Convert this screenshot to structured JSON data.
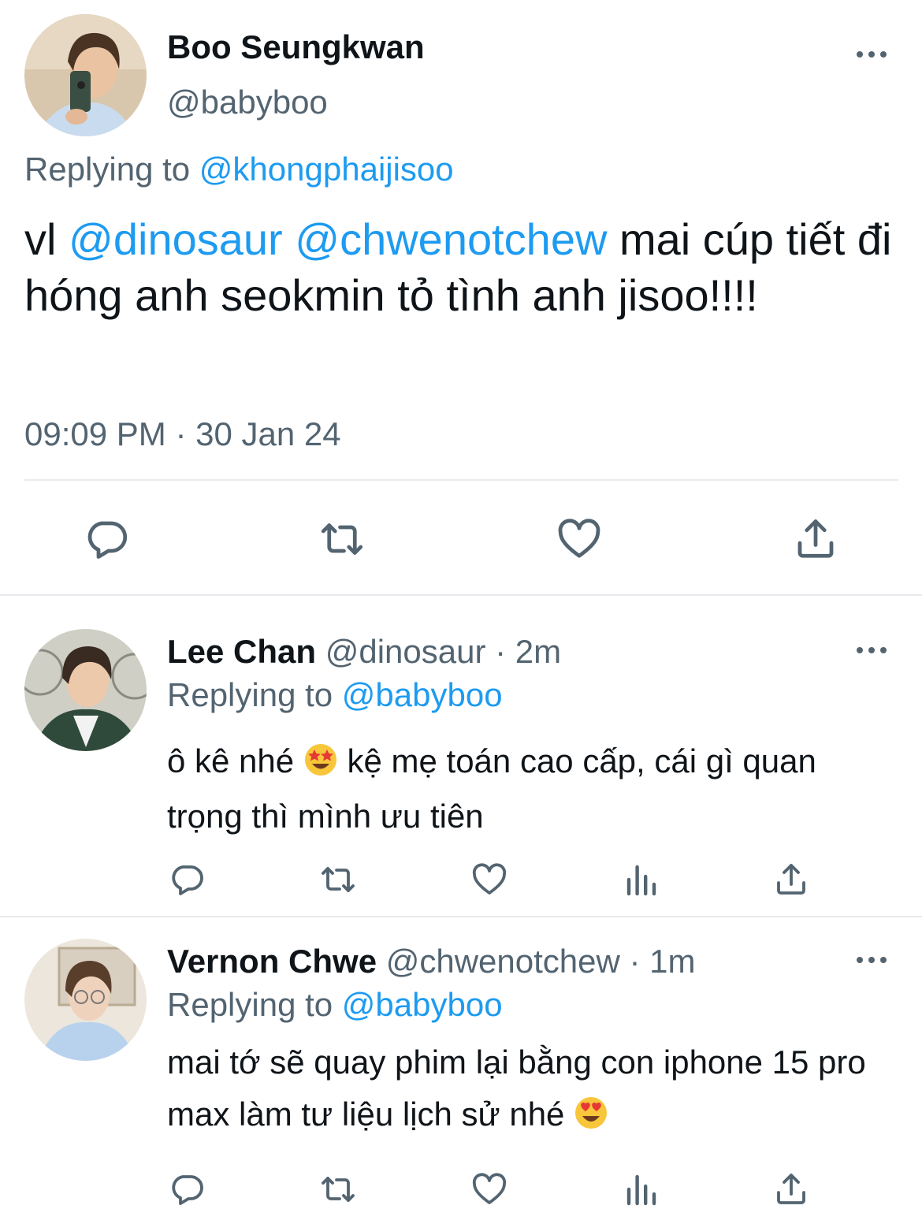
{
  "main_tweet": {
    "display_name": "Boo Seungkwan",
    "handle": "@babyboo",
    "replying_label": "Replying to",
    "replying_to": "@khongphaijisoo",
    "text_start": "vl",
    "mention_1": "@dinosaur",
    "mention_2": "@chwenotchew",
    "text_end": "mai cúp tiết đi hóng anh seokmin tỏ tình anh jisoo!!!!",
    "timestamp": "09:09 PM · 30 Jan 24"
  },
  "replies": [
    {
      "display_name": "Lee Chan",
      "handle": "@dinosaur",
      "time": "· 2m",
      "replying_label": "Replying to",
      "replying_to": "@babyboo",
      "text_before_emoji": "ô kê nhé",
      "emoji": "star-struck-emoji",
      "text_after_emoji": "kệ mẹ toán cao cấp, cái gì quan trọng thì mình ưu tiên"
    },
    {
      "display_name": "Vernon Chwe",
      "handle": "@chwenotchew",
      "time": "· 1m",
      "replying_label": "Replying to",
      "replying_to": "@babyboo",
      "text_before_emoji": "mai tớ sẽ quay phim lại bằng con iphone 15 pro max làm tư liệu lịch sử nhé",
      "emoji": "heart-eyes-emoji"
    }
  ],
  "icons": [
    "reply-icon",
    "retweet-icon",
    "like-icon",
    "views-icon",
    "share-icon",
    "more-icon"
  ],
  "colors": {
    "link": "#1d9bf0",
    "secondary_text": "#536471",
    "icon": "#536471",
    "divider": "#e8ebee"
  }
}
